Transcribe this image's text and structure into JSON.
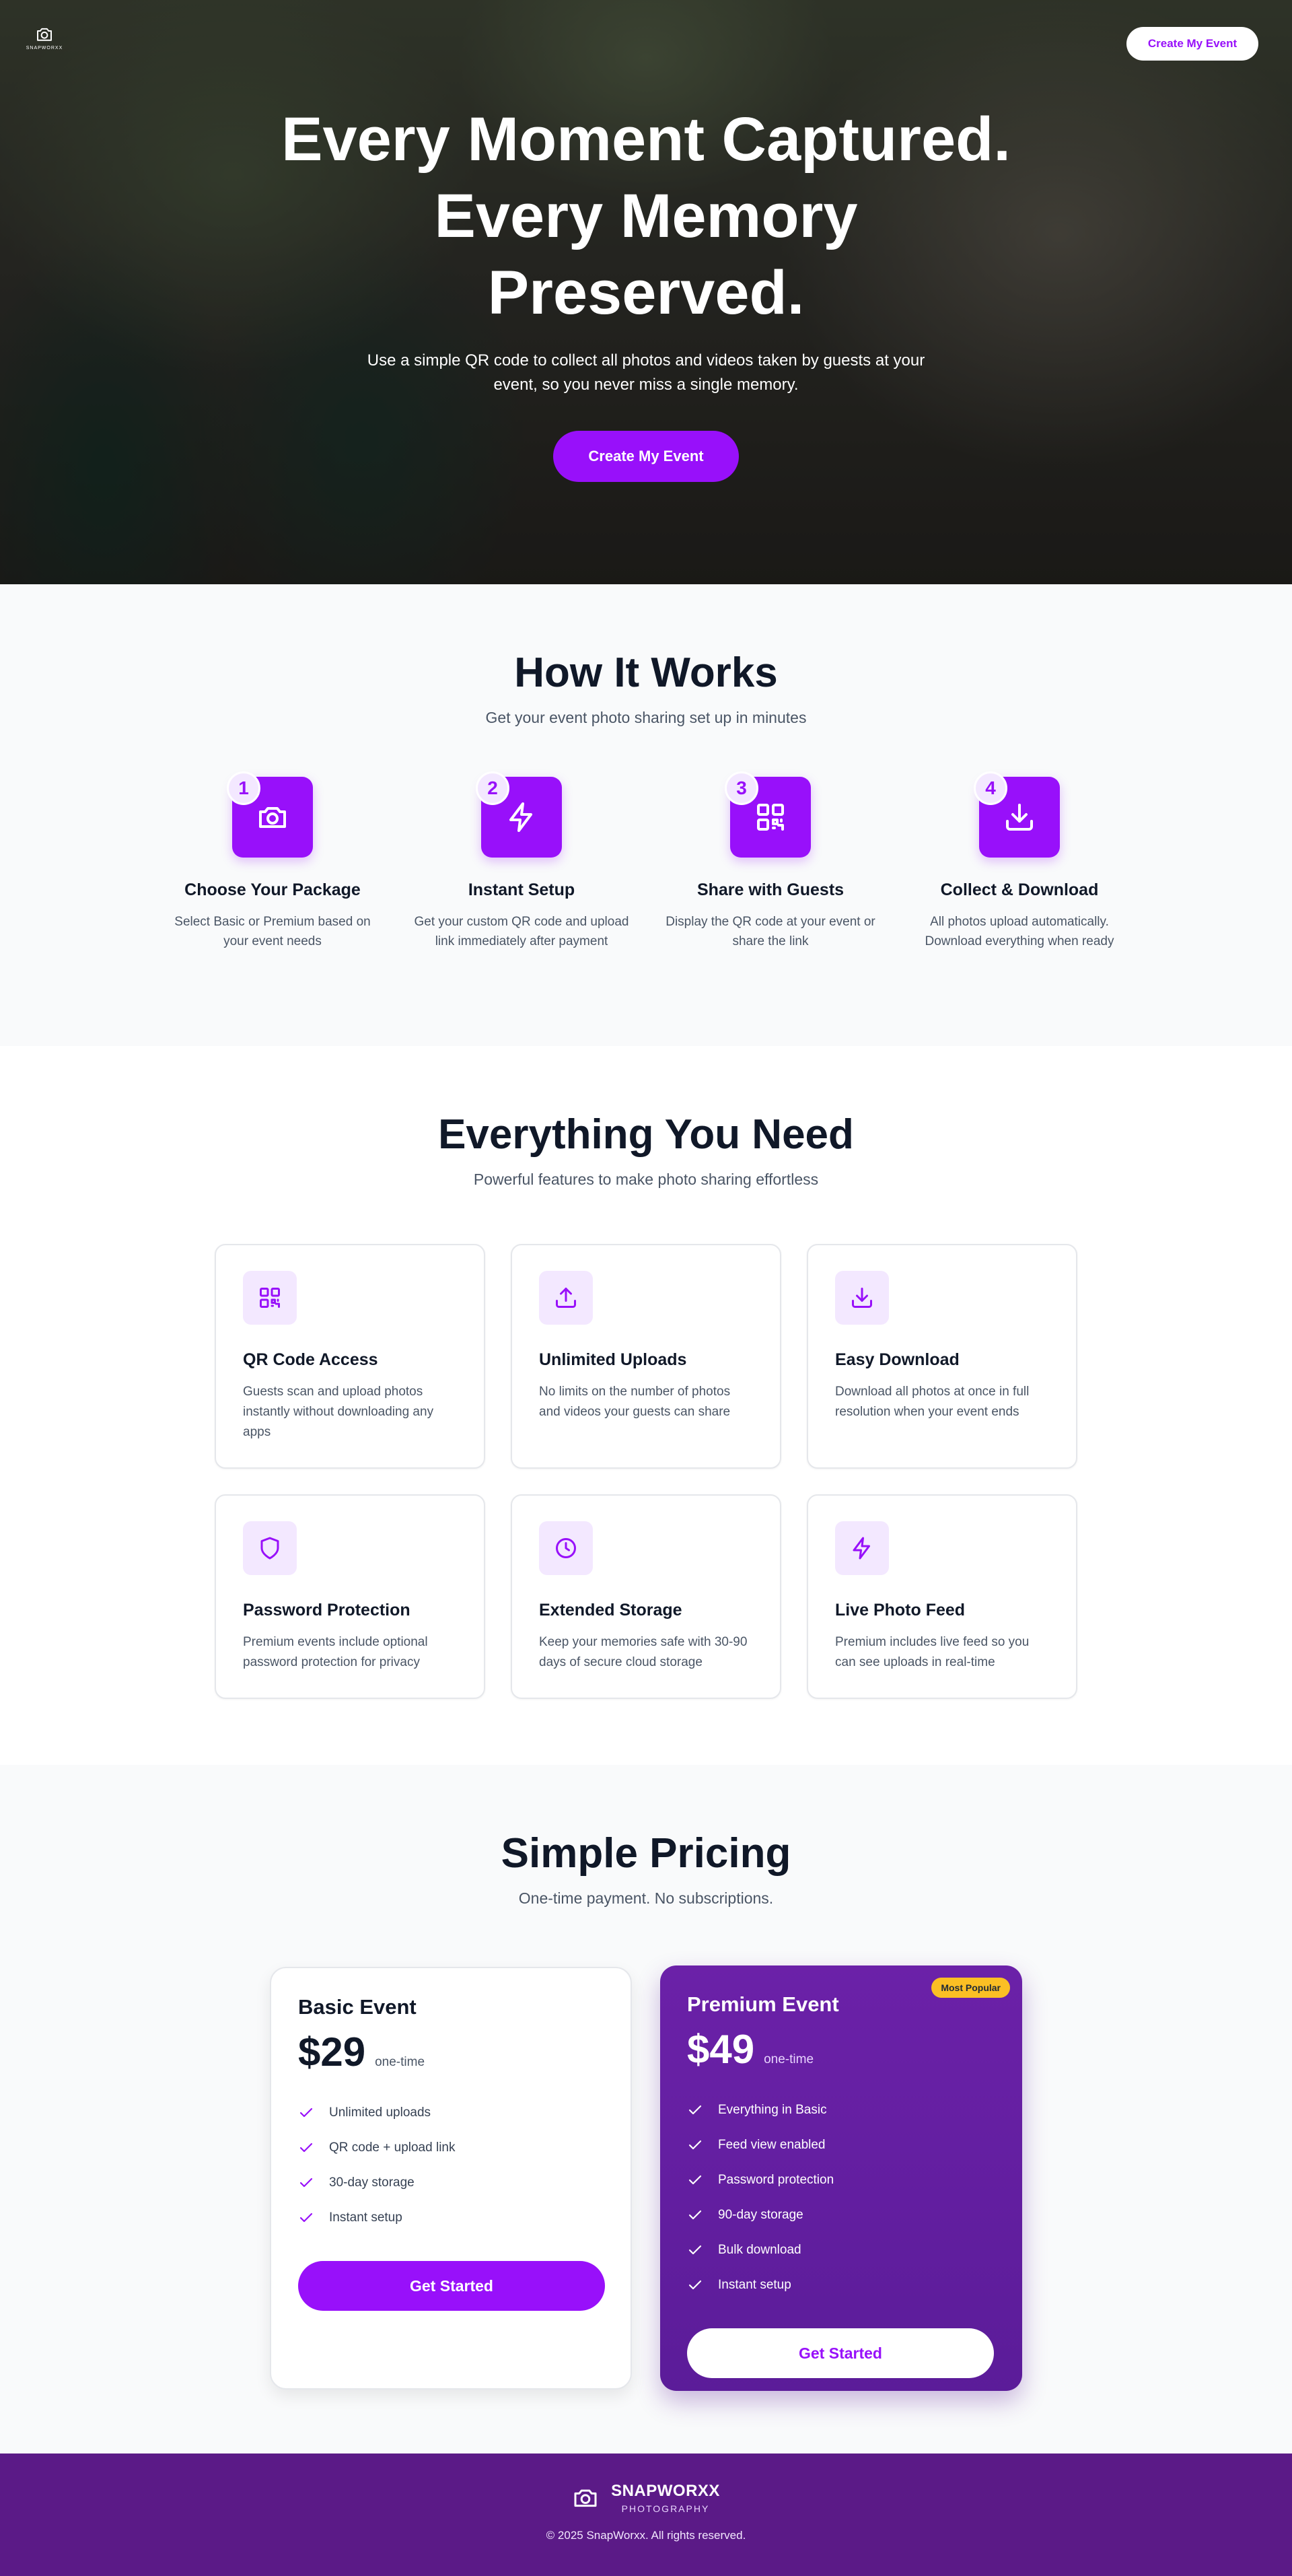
{
  "header": {
    "logo_text": "SNAPWORXX",
    "nav_cta": "Create My Event"
  },
  "hero": {
    "title_line1": "Every Moment Captured.",
    "title_line2": "Every Memory",
    "title_line3": "Preserved.",
    "subtitle": "Use a simple QR code to collect all photos and videos taken by guests at your event, so you never miss a single memory.",
    "cta": "Create My Event"
  },
  "how": {
    "title": "How It Works",
    "subtitle": "Get your event photo sharing set up in minutes",
    "steps": [
      {
        "number": "1",
        "icon": "camera-icon",
        "title": "Choose Your Package",
        "text": "Select Basic or Premium based on your event needs"
      },
      {
        "number": "2",
        "icon": "lightning-icon",
        "title": "Instant Setup",
        "text": "Get your custom QR code and upload link immediately after payment"
      },
      {
        "number": "3",
        "icon": "qr-code-icon",
        "title": "Share with Guests",
        "text": "Display the QR code at your event or share the link"
      },
      {
        "number": "4",
        "icon": "download-icon",
        "title": "Collect & Download",
        "text": "All photos upload automatically. Download everything when ready"
      }
    ]
  },
  "features": {
    "title": "Everything You Need",
    "subtitle": "Powerful features to make photo sharing effortless",
    "items": [
      {
        "icon": "qr-code-icon",
        "title": "QR Code Access",
        "text": "Guests scan and upload photos instantly without downloading any apps"
      },
      {
        "icon": "upload-icon",
        "title": "Unlimited Uploads",
        "text": "No limits on the number of photos and videos your guests can share"
      },
      {
        "icon": "download-icon",
        "title": "Easy Download",
        "text": "Download all photos at once in full resolution when your event ends"
      },
      {
        "icon": "shield-icon",
        "title": "Password Protection",
        "text": "Premium events include optional password protection for privacy"
      },
      {
        "icon": "clock-icon",
        "title": "Extended Storage",
        "text": "Keep your memories safe with 30-90 days of secure cloud storage"
      },
      {
        "icon": "lightning-icon",
        "title": "Live Photo Feed",
        "text": "Premium includes live feed so you can see uploads in real-time"
      }
    ]
  },
  "pricing": {
    "title": "Simple Pricing",
    "subtitle": "One-time payment. No subscriptions.",
    "plans": [
      {
        "name": "Basic Event",
        "price": "$29",
        "period": "one-time",
        "features": [
          "Unlimited uploads",
          "QR code + upload link",
          "30-day storage",
          "Instant setup"
        ],
        "cta": "Get Started"
      },
      {
        "name": "Premium Event",
        "price": "$49",
        "period": "one-time",
        "badge": "Most Popular",
        "features": [
          "Everything in Basic",
          "Feed view enabled",
          "Password protection",
          "90-day storage",
          "Bulk download",
          "Instant setup"
        ],
        "cta": "Get Started"
      }
    ]
  },
  "footer": {
    "brand": "SNAPWORXX",
    "tagline": "PHOTOGRAPHY",
    "copyright": "© 2025 SnapWorxx. All rights reserved."
  },
  "colors": {
    "accent": "#9810fa",
    "premium_bg": "#6b21a8",
    "footer_bg": "#5b1a87",
    "badge": "#fbbf24"
  }
}
